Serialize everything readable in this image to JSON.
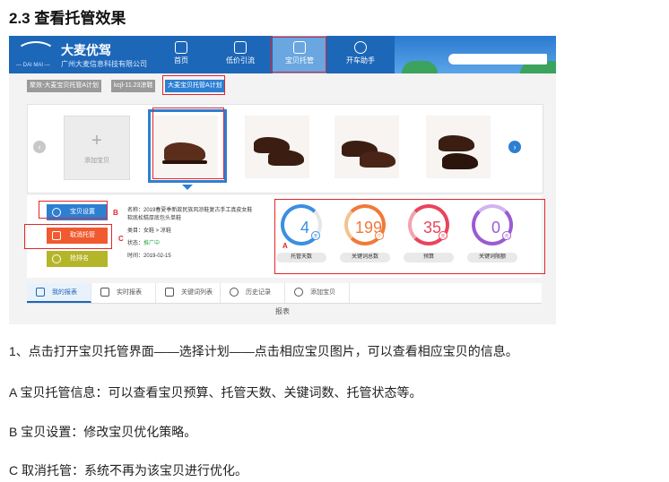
{
  "heading": "2.3 查看托管效果",
  "app": {
    "logo_sub": "— DAI MAI —",
    "brand": "大麦优驾",
    "company": "广州大麦信息科技有限公司",
    "nav": [
      {
        "label": "首页"
      },
      {
        "label": "低价引流"
      },
      {
        "label": "宝贝托管"
      },
      {
        "label": "开车助手"
      }
    ]
  },
  "breadcrumbs": [
    {
      "label": "聚效-大麦宝贝托管A计划"
    },
    {
      "label": "kcjl-11.23凉鞋"
    },
    {
      "label": "大麦宝贝托管A计划"
    }
  ],
  "gallery": {
    "prev": "‹",
    "next": "›",
    "add_plus": "+",
    "add_label": "添加宝贝"
  },
  "side_buttons": [
    {
      "label": "宝贝设置"
    },
    {
      "label": "取消托管"
    },
    {
      "label": "抢排名"
    }
  ],
  "markers": {
    "a": "A",
    "b": "B",
    "c": "C"
  },
  "item_info": {
    "name_1": "名称：2019春夏季新款民族风凉鞋复古手工真皮女鞋",
    "name_2": "软底松糕厚底包头单鞋",
    "category": "类目：女鞋 > 凉鞋",
    "status_label": "状态：",
    "status_value": "推广中",
    "time": "时间：2019-02-15"
  },
  "stats": [
    {
      "value": "4",
      "label": "托管天数",
      "badge": "天",
      "color": "#3b8fe0"
    },
    {
      "value": "199",
      "label": "关键词总数",
      "badge": "个",
      "color": "#f07a3a"
    },
    {
      "value": "35",
      "label": "预算",
      "badge": "元",
      "color": "#e8455c"
    },
    {
      "value": "0",
      "label": "关键词限额",
      "badge": "元",
      "color": "#9a5bd3"
    }
  ],
  "tabs": [
    {
      "label": "我的报表"
    },
    {
      "label": "实时报表"
    },
    {
      "label": "关键词列表"
    },
    {
      "label": "历史记录"
    },
    {
      "label": "添加宝贝"
    }
  ],
  "report_label": "报表",
  "paragraphs": [
    "1、点击打开宝贝托管界面——选择计划——点击相应宝贝图片，可以查看相应宝贝的信息。",
    "A 宝贝托管信息：可以查看宝贝预算、托管天数、关键词数、托管状态等。",
    "B 宝贝设置：修改宝贝优化策略。",
    "C 取消托管：系统不再为该宝贝进行优化。"
  ],
  "colors": {
    "header_blue": "#1d67b8",
    "annotation_red": "#e3262b",
    "btn_blue": "#2d7fd2",
    "btn_orange": "#f05a2e",
    "btn_olive": "#b5b52a"
  }
}
